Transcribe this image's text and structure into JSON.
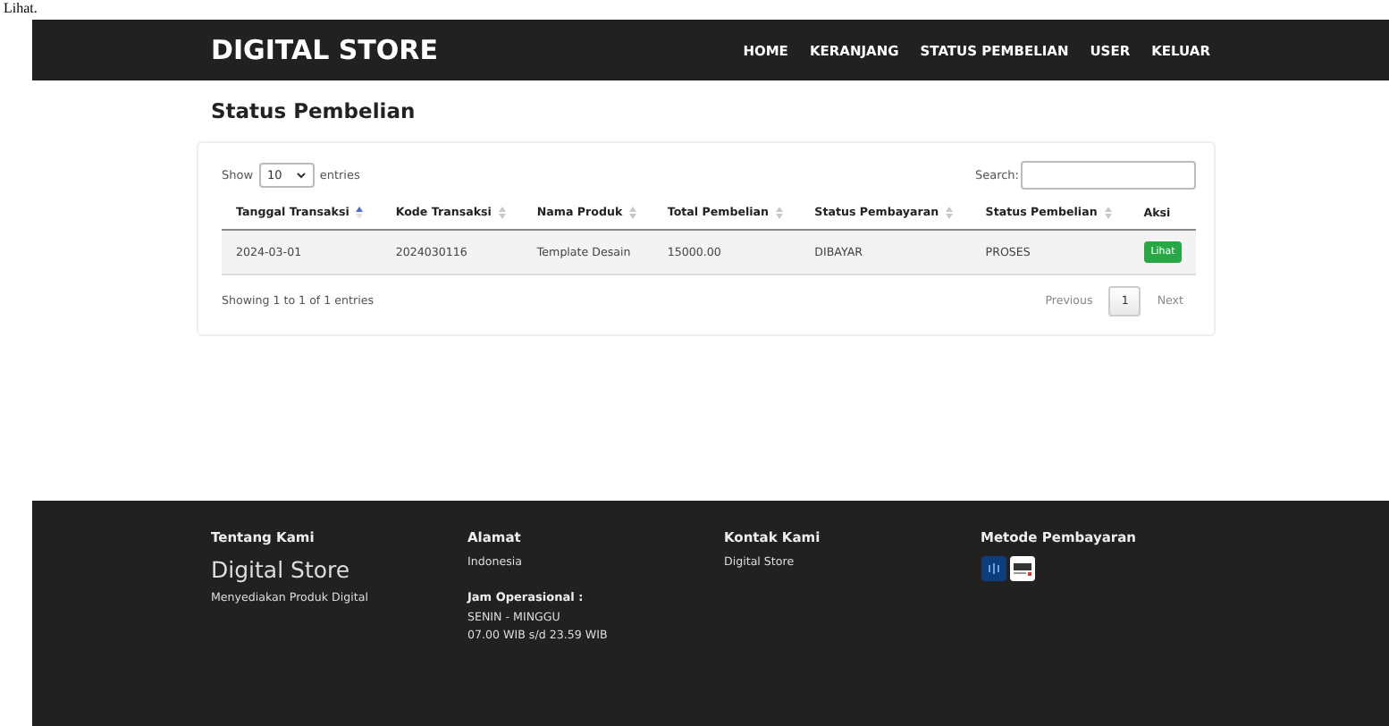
{
  "top_text": "Lihat.",
  "header": {
    "brand": "DIGITAL STORE",
    "nav": [
      "HOME",
      "KERANJANG",
      "STATUS PEMBELIAN",
      "USER",
      "KELUAR"
    ]
  },
  "page_title": "Status Pembelian",
  "table": {
    "length_label_before": "Show",
    "length_value": "10",
    "length_label_after": "entries",
    "search_label": "Search:",
    "columns": [
      {
        "label": "Tanggal Transaksi",
        "sortable": true,
        "sorted": true
      },
      {
        "label": "Kode Transaksi",
        "sortable": true,
        "sorted": false
      },
      {
        "label": "Nama Produk",
        "sortable": true,
        "sorted": false
      },
      {
        "label": "Total Pembelian",
        "sortable": true,
        "sorted": false
      },
      {
        "label": "Status Pembayaran",
        "sortable": true,
        "sorted": false
      },
      {
        "label": "Status Pembelian",
        "sortable": true,
        "sorted": false
      },
      {
        "label": "Aksi",
        "sortable": false
      }
    ],
    "rows": [
      {
        "cells": [
          "2024-03-01",
          "2024030116",
          "Template Desain",
          "15000.00",
          "DIBAYAR",
          "PROSES"
        ],
        "action": "Lihat"
      }
    ],
    "info": "Showing 1 to 1 of 1 entries",
    "pagination": [
      {
        "label": "Previous",
        "selected": false
      },
      {
        "label": "1",
        "selected": true
      },
      {
        "label": "Next",
        "selected": false
      }
    ]
  },
  "footer": {
    "columns": [
      {
        "heading": "Tentang Kami",
        "items": [
          {
            "kind": "brand",
            "text": "Digital Store"
          },
          {
            "kind": "text",
            "text": "Menyediakan Produk Digital"
          }
        ]
      },
      {
        "heading": "Alamat",
        "items": [
          {
            "kind": "text",
            "text": "Indonesia"
          },
          {
            "kind": "subheading",
            "text": "Jam Operasional :"
          },
          {
            "kind": "text",
            "text": "SENIN - MINGGU"
          },
          {
            "kind": "text",
            "text": "07.00 WIB s/d 23.59 WIB"
          }
        ]
      },
      {
        "heading": "Kontak Kami",
        "items": [
          {
            "kind": "text",
            "text": "Digital Store"
          }
        ]
      },
      {
        "heading": "Metode Pembayaran",
        "items": [
          {
            "kind": "payment-icons"
          }
        ]
      }
    ]
  }
}
